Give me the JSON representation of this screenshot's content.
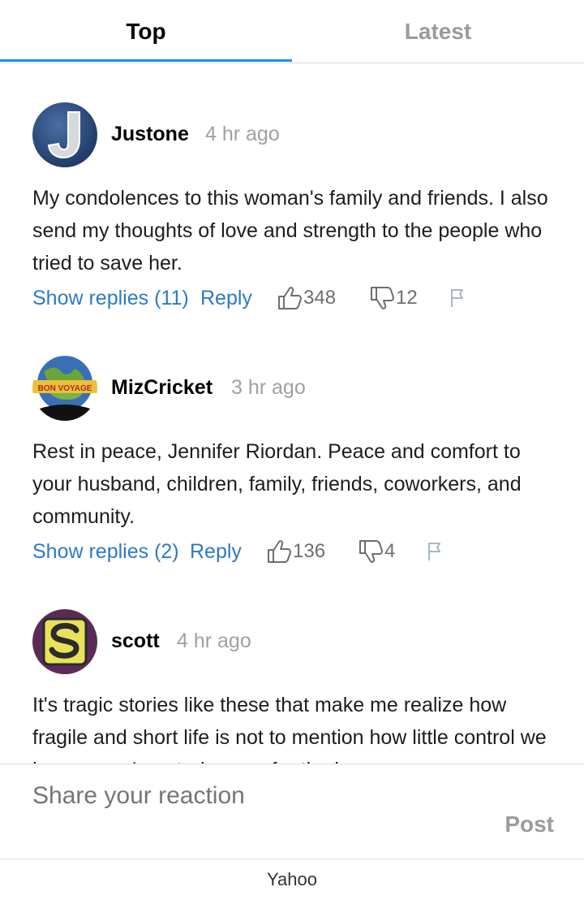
{
  "tabs": [
    {
      "label": "Top",
      "active": true
    },
    {
      "label": "Latest",
      "active": false
    }
  ],
  "accent_color": "#188fff",
  "link_color": "#2d7ac6",
  "comments": [
    {
      "username": "Justone",
      "time": "4 hr ago",
      "avatar_icon": "letter-j-avatar",
      "text": "My condolences to this woman's family and friends. I also send my thoughts of love and strength to the people who tried to save her.",
      "show_replies": "Show replies (11)",
      "reply": "Reply",
      "likes": "348",
      "dislikes": "12"
    },
    {
      "username": "MizCricket",
      "time": "3 hr ago",
      "avatar_icon": "bon-voyage-globe-avatar",
      "avatar_text": "BON VOYAGE",
      "text": "Rest in peace, Jennifer Riordan. Peace and comfort to your husband, children, family, friends, coworkers, and community.",
      "show_replies": "Show replies (2)",
      "reply": "Reply",
      "likes": "136",
      "dislikes": "4"
    },
    {
      "username": "scott",
      "time": "4 hr ago",
      "avatar_icon": "letter-s-avatar",
      "text": "It's tragic stories like these that make me realize how fragile and short life is not to mention how little control we have over. I am truly sorry for the loss"
    }
  ],
  "composer": {
    "placeholder": "Share your reaction",
    "post_label": "Post"
  },
  "footer": {
    "brand": "Yahoo"
  }
}
